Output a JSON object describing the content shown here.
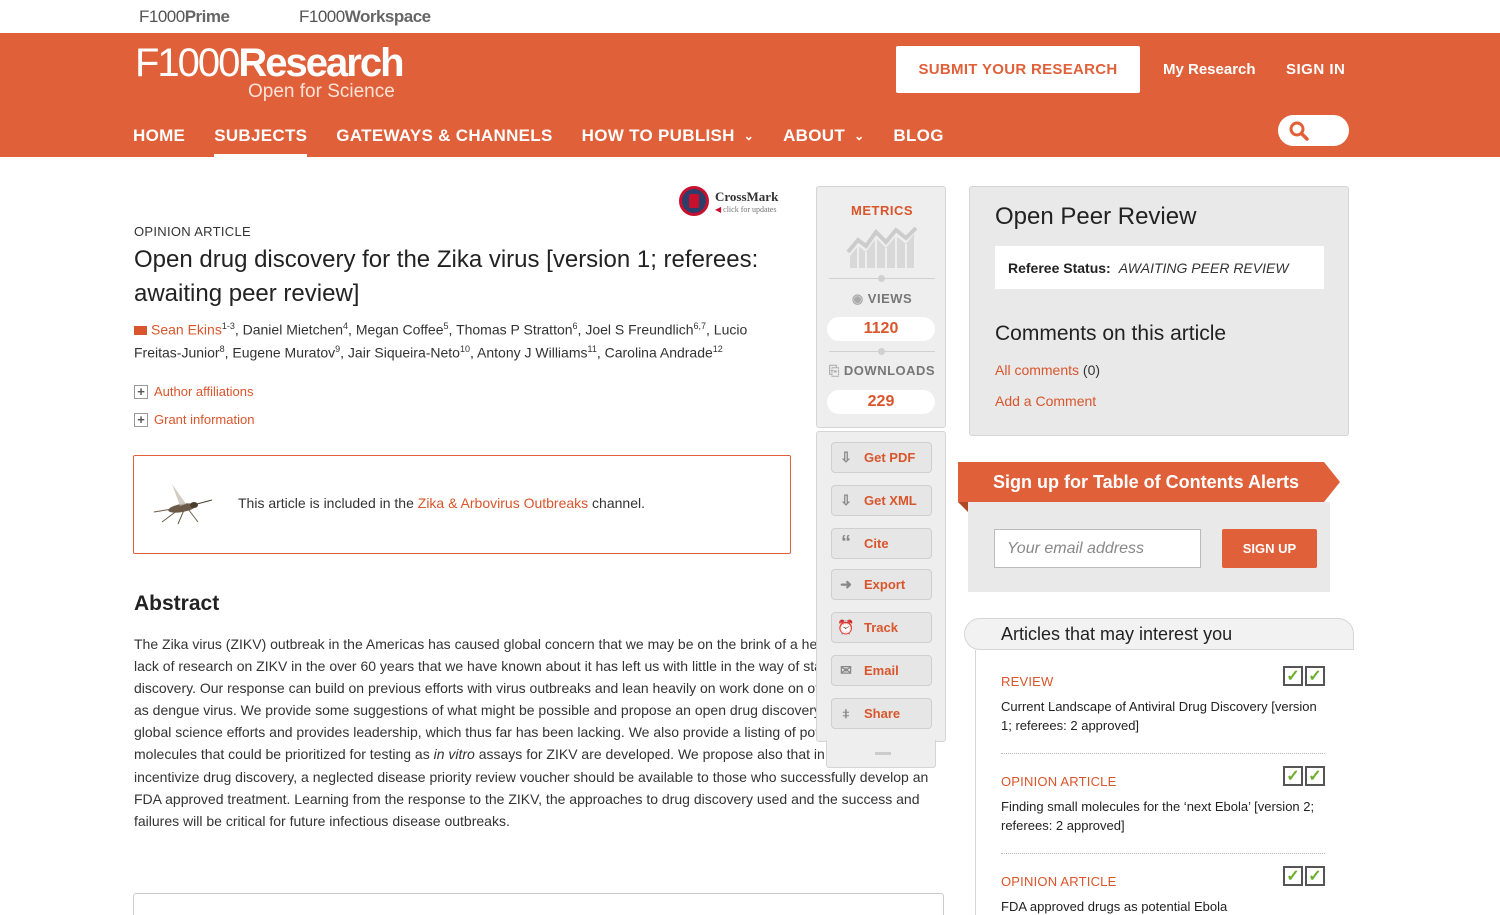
{
  "topstrip": {
    "brand1_light": "F1000",
    "brand1_bold": "Prime",
    "brand2_light": "F1000",
    "brand2_bold": "Workspace"
  },
  "header": {
    "logo_light": "F1000",
    "logo_bold": "Research",
    "tagline": "Open for Science",
    "submit_label": "SUBMIT YOUR RESEARCH",
    "my_research": "My Research",
    "sign_in": "SIGN IN",
    "accent_color": "#e0603a"
  },
  "nav": {
    "items": [
      {
        "label": "HOME"
      },
      {
        "label": "SUBJECTS"
      },
      {
        "label": "GATEWAYS & CHANNELS"
      },
      {
        "label": "HOW TO PUBLISH"
      },
      {
        "label": "ABOUT"
      },
      {
        "label": "BLOG"
      }
    ],
    "active": "SUBJECTS",
    "search_icon": "search-icon"
  },
  "crossmark": {
    "title": "CrossMark",
    "sub": "click for updates"
  },
  "article": {
    "type": "OPINION ARTICLE",
    "title": "Open drug discovery for the Zika virus [version 1; referees: awaiting peer review]",
    "authors": [
      {
        "name": "Sean Ekins",
        "sup": "1-3"
      },
      {
        "name": "Daniel Mietchen",
        "sup": "4"
      },
      {
        "name": "Megan Coffee",
        "sup": "5"
      },
      {
        "name": "Thomas P Stratton",
        "sup": "6"
      },
      {
        "name": "Joel S Freundlich",
        "sup": "6,7"
      },
      {
        "name": "Lucio Freitas-Junior",
        "sup": "8"
      },
      {
        "name": "Eugene Muratov",
        "sup": "9"
      },
      {
        "name": "Jair Siqueira-Neto",
        "sup": "10"
      },
      {
        "name": "Antony J Williams",
        "sup": "11"
      },
      {
        "name": "Carolina Andrade",
        "sup": "12"
      }
    ],
    "affiliations_label": "Author affiliations",
    "grant_label": "Grant information",
    "channel_prefix": "This article is included in the ",
    "channel_link": "Zika & Arbovirus Outbreaks",
    "channel_suffix": " channel.",
    "abstract_heading": "Abstract",
    "abstract_p1": "The Zika virus (ZIKV) outbreak in the Americas has caused global concern that we may be on the brink of a healthcare crisis. The lack of research on ZIKV in the over 60 years that we have known about it has left us with little in the way of starting points for drug discovery. Our response can build on previous efforts with virus outbreaks and lean heavily on work done on other flaviviruses such as dengue virus. We provide some suggestions of what might be possible and propose an open drug discovery effort that mobilizes global science efforts and provides leadership, which thus far has been lacking. We also provide a listing of potential resources and molecules that could be prioritized for testing as ",
    "abstract_italic": "in vitro",
    "abstract_p2": " assays for ZIKV are developed. We propose also that in order to incentivize drug discovery, a neglected disease priority review voucher should be available to those who successfully develop an FDA approved treatment. Learning from the response to the ZIKV, the approaches to drug discovery used and the success and failures will be critical for future infectious disease outbreaks."
  },
  "metrics": {
    "label": "METRICS",
    "views_label": "VIEWS",
    "views": "1120",
    "downloads_label": "DOWNLOADS",
    "downloads": "229"
  },
  "tools": [
    {
      "label": "Get PDF",
      "icon": "pdf-icon"
    },
    {
      "label": "Get XML",
      "icon": "xml-icon"
    },
    {
      "label": "Cite",
      "icon": "quote-icon"
    },
    {
      "label": "Export",
      "icon": "export-icon"
    },
    {
      "label": "Track",
      "icon": "alarm-clock-icon"
    },
    {
      "label": "Email",
      "icon": "envelope-icon"
    },
    {
      "label": "Share",
      "icon": "share-icon"
    }
  ],
  "peer_review": {
    "heading": "Open Peer Review",
    "status_label": "Referee Status:",
    "status_value": "AWAITING PEER REVIEW",
    "comments_heading": "Comments on this article",
    "all_comments": "All comments",
    "all_comments_count": "(0)",
    "add_comment": "Add a Comment"
  },
  "toc": {
    "heading": "Sign up for Table of Contents Alerts",
    "email_placeholder": "Your email address",
    "signup_label": "SIGN UP"
  },
  "interest": {
    "heading": "Articles that may interest you",
    "items": [
      {
        "type": "REVIEW",
        "title": "Current Landscape of Antiviral Drug Discovery [version 1; referees: 2 approved]"
      },
      {
        "type": "OPINION ARTICLE",
        "title": "Finding small molecules for the ‘next Ebola’ [version 2; referees: 2 approved]"
      },
      {
        "type": "OPINION ARTICLE",
        "title": "FDA approved drugs as potential Ebola"
      }
    ]
  }
}
